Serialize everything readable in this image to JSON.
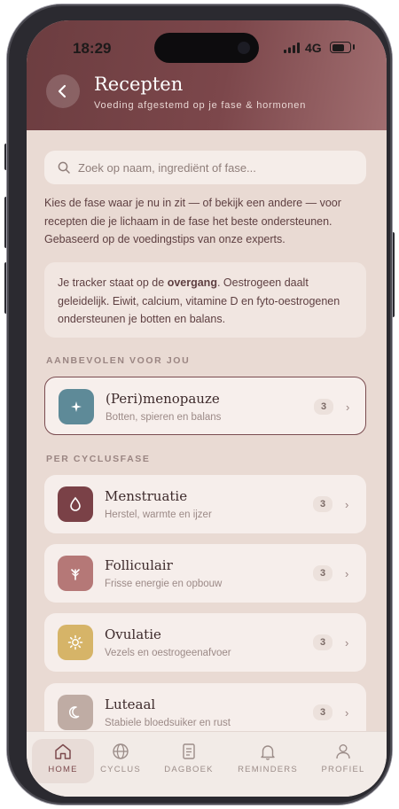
{
  "status_bar": {
    "time": "18:29",
    "network": "4G"
  },
  "header": {
    "title": "Recepten",
    "subtitle": "Voeding afgestemd op je fase & hormonen"
  },
  "search": {
    "placeholder": "Zoek op naam, ingrediënt of fase..."
  },
  "intro_text": "Kies de fase waar je nu in zit — of bekijk een andere — voor recepten die je lichaam in de fase het beste ondersteunen. Gebaseerd op de voedingstips van onze experts.",
  "tracker_info": {
    "before": "Je tracker staat op de ",
    "highlight": "overgang",
    "after": ". Oestrogeen daalt geleidelijk. Eiwit, calcium, vitamine D en fyto-oestrogenen ondersteunen je botten en balans."
  },
  "recommended": {
    "heading": "AANBEVOLEN VOOR JOU",
    "card": {
      "name": "(Peri)menopauze",
      "description": "Botten, spieren en balans",
      "count": "3",
      "icon": "sparkle-icon",
      "color": "#5e8a98"
    }
  },
  "phases": {
    "heading": "PER CYCLUSFASE",
    "cards": [
      {
        "name": "Menstruatie",
        "description": "Herstel, warmte en ijzer",
        "count": "3",
        "icon": "drop-icon",
        "color": "#7a4147"
      },
      {
        "name": "Folliculair",
        "description": "Frisse energie en opbouw",
        "count": "3",
        "icon": "sprout-icon",
        "color": "#b57877"
      },
      {
        "name": "Ovulatie",
        "description": "Vezels en oestrogeenafvoer",
        "count": "3",
        "icon": "sun-icon",
        "color": "#d6b468"
      },
      {
        "name": "Luteaal",
        "description": "Stabiele bloedsuiker en rust",
        "count": "3",
        "icon": "moon-icon",
        "color": "#bfaca4"
      }
    ]
  },
  "tabs": [
    {
      "label": "HOME",
      "icon": "home-icon",
      "active": true
    },
    {
      "label": "CYCLUS",
      "icon": "globe-icon",
      "active": false
    },
    {
      "label": "DAGBOEK",
      "icon": "journal-icon",
      "active": false
    },
    {
      "label": "REMINDERS",
      "icon": "bell-icon",
      "active": false
    },
    {
      "label": "PROFIEL",
      "icon": "user-icon",
      "active": false
    }
  ],
  "colors": {
    "header": "#7c474b",
    "accent": "#7a4c50",
    "background": "#e9dad3"
  }
}
